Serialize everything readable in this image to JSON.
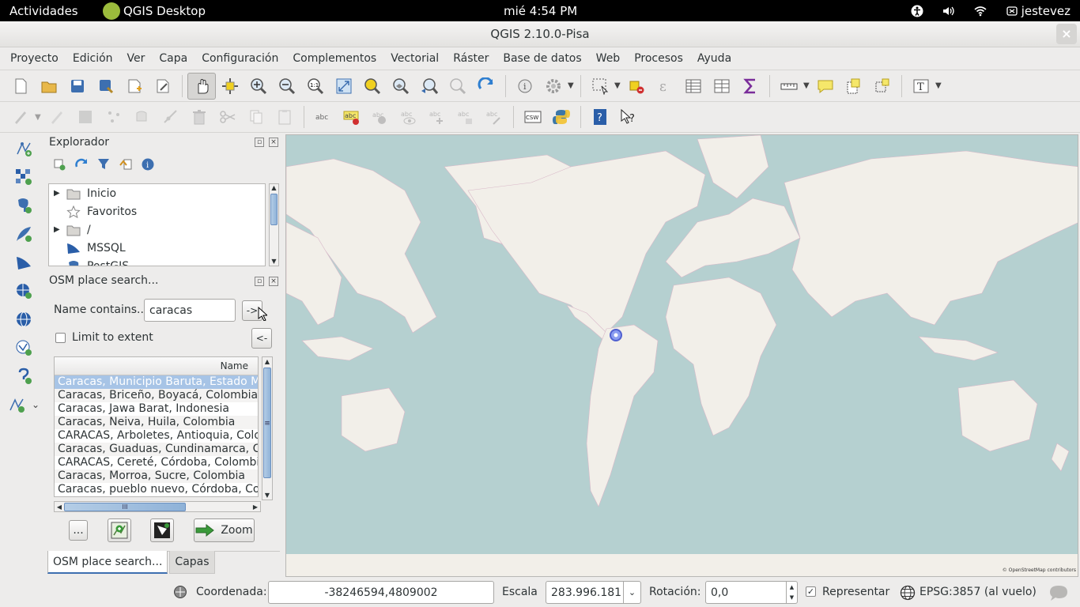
{
  "topbar": {
    "activities": "Actividades",
    "app_name": "QGIS Desktop",
    "clock": "mié  4:54 PM",
    "user": "jestevez"
  },
  "window": {
    "title": "QGIS 2.10.0-Pisa",
    "close": "×"
  },
  "menus": [
    "Proyecto",
    "Edición",
    "Ver",
    "Capa",
    "Configuración",
    "Complementos",
    "Vectorial",
    "Ráster",
    "Base de datos",
    "Web",
    "Procesos",
    "Ayuda"
  ],
  "toolbar2": {
    "csw_label": "CSW",
    "label_abc": "abc"
  },
  "browser": {
    "title": "Explorador",
    "items": [
      {
        "label": "Inicio",
        "expandable": true,
        "icon": "folder-icon"
      },
      {
        "label": "Favoritos",
        "expandable": false,
        "icon": "star-icon"
      },
      {
        "label": "/",
        "expandable": true,
        "icon": "folder-icon"
      },
      {
        "label": "MSSQL",
        "expandable": false,
        "icon": "mssql-icon"
      },
      {
        "label": "PostGIS",
        "expandable": false,
        "icon": "postgis-icon"
      }
    ]
  },
  "osm": {
    "title": "OSM place search...",
    "name_label": "Name contains...",
    "name_value": "caracas",
    "go_label": "->",
    "back_label": "<-",
    "limit_label": "Limit to extent",
    "limit_checked": false,
    "column_header": "Name",
    "results": [
      "Caracas, Municipio Baruta, Estado Miranda",
      "Caracas, Briceño, Boyacá, Colombia",
      "Caracas, Jawa Barat, Indonesia",
      "Caracas, Neiva, Huila, Colombia",
      "CARACAS, Arboletes, Antioquia, Colombia",
      "Caracas, Guaduas, Cundinamarca, Colombia",
      "CARACAS, Cereté, Córdoba, Colombia",
      "Caracas, Morroa, Sucre, Colombia",
      "Caracas, pueblo nuevo, Córdoba, Colombia"
    ],
    "selected_index": 0,
    "more_label": "...",
    "zoom_label": "Zoom",
    "hscroll_glyph": "III",
    "vscroll_glyph": "≡"
  },
  "tabs": [
    {
      "label": "OSM place search...",
      "active": true
    },
    {
      "label": "Capas",
      "active": false
    }
  ],
  "map": {
    "attribution": "© OpenStreetMap contributors",
    "ocean_color": "#b5d0d0",
    "land_color": "#f2efe9"
  },
  "status": {
    "coord_label": "Coordenada:",
    "coord_value": "-38246594,4809002",
    "scale_label": "Escala",
    "scale_value": "283.996.181",
    "rotation_label": "Rotación:",
    "rotation_value": "0,0",
    "render_label": "Representar",
    "render_checked": true,
    "crs_label": "EPSG:3857 (al vuelo)"
  }
}
